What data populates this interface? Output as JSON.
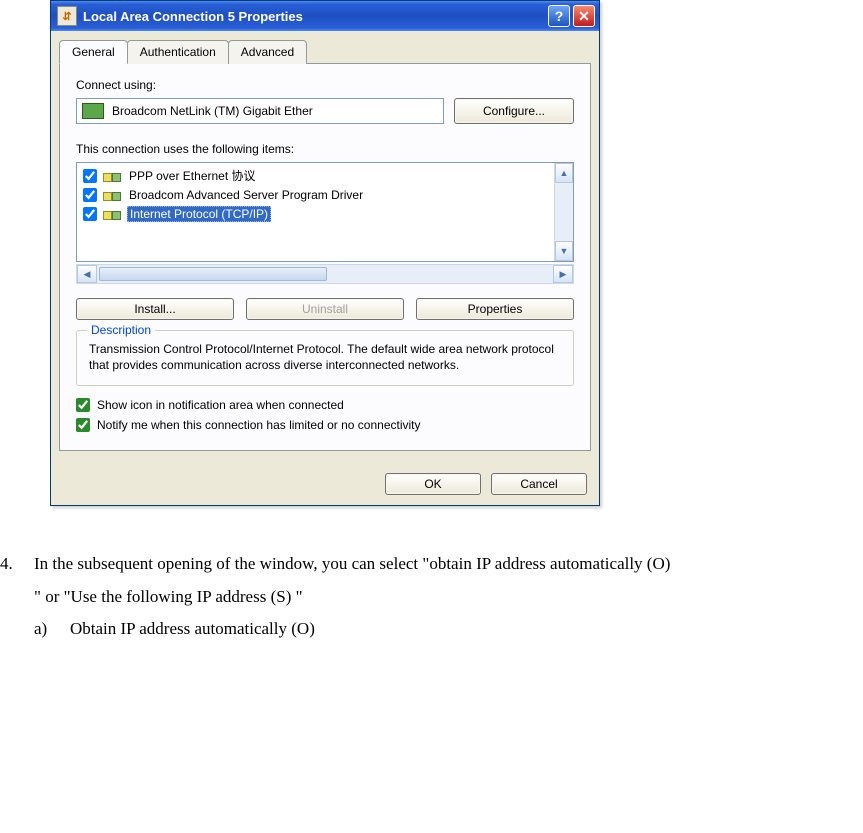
{
  "titlebar": {
    "title": "Local Area Connection 5 Properties"
  },
  "tabs": {
    "general": "General",
    "authentication": "Authentication",
    "advanced": "Advanced"
  },
  "connect": {
    "label": "Connect using:",
    "adapter": "Broadcom NetLink (TM) Gigabit Ether",
    "configure_btn": "Configure..."
  },
  "items": {
    "label": "This connection uses the following items:",
    "list": [
      {
        "label": "PPP over Ethernet 协议",
        "checked": true,
        "selected": false
      },
      {
        "label": "Broadcom Advanced Server Program Driver",
        "checked": true,
        "selected": false
      },
      {
        "label": "Internet Protocol (TCP/IP)",
        "checked": true,
        "selected": true
      }
    ]
  },
  "buttons": {
    "install": "Install...",
    "uninstall": "Uninstall",
    "properties": "Properties"
  },
  "description": {
    "legend": "Description",
    "text": "Transmission Control Protocol/Internet Protocol. The default wide area network protocol that provides communication across diverse interconnected networks."
  },
  "checks": {
    "show_icon": "Show icon in notification area when connected",
    "notify": "Notify me when this connection has limited or no connectivity"
  },
  "footer": {
    "ok": "OK",
    "cancel": "Cancel"
  },
  "instruction": {
    "number": "4.",
    "line1": "In the subsequent opening of the window, you can select \"obtain IP address automatically (O)",
    "line2": "\" or \"Use the following IP address (S) \"",
    "sub_label": "a)",
    "sub_text": "Obtain IP address automatically (O)"
  }
}
